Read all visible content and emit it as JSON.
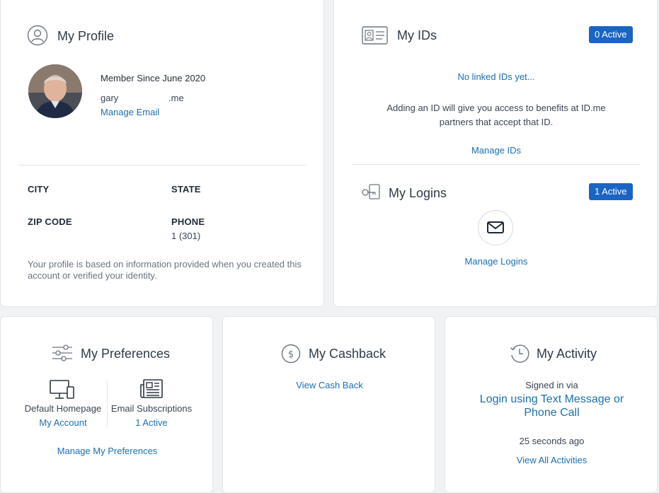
{
  "profile": {
    "title": "My Profile",
    "member_since": "Member Since June 2020",
    "email_user": "gary",
    "email_domain": ".me",
    "manage_email": "Manage Email",
    "city_label": "CITY",
    "state_label": "STATE",
    "zip_label": "ZIP CODE",
    "phone_label": "PHONE",
    "phone_value": "1 (301)",
    "note": "Your profile is based on information provided when you created this account or verified your identity."
  },
  "ids": {
    "title": "My IDs",
    "badge": "0 Active",
    "empty": "No linked IDs yet...",
    "description": "Adding an ID will give you access to benefits at ID.me partners that accept that ID.",
    "manage": "Manage IDs"
  },
  "logins": {
    "title": "My Logins",
    "badge": "1 Active",
    "manage": "Manage Logins"
  },
  "preferences": {
    "title": "My Preferences",
    "homepage_label": "Default Homepage",
    "homepage_value": "My Account",
    "subscriptions_label": "Email Subscriptions",
    "subscriptions_value": "1 Active",
    "manage": "Manage My Preferences"
  },
  "cashback": {
    "title": "My Cashback",
    "view": "View Cash Back"
  },
  "activity": {
    "title": "My Activity",
    "signed_in_via": "Signed in via",
    "method": "Login using Text Message or Phone Call",
    "time": "25 seconds ago",
    "view_all": "View All Activities"
  },
  "colors": {
    "accent": "#1a6fb3",
    "badge": "#1a64c4",
    "background": "#f1f2f4"
  }
}
